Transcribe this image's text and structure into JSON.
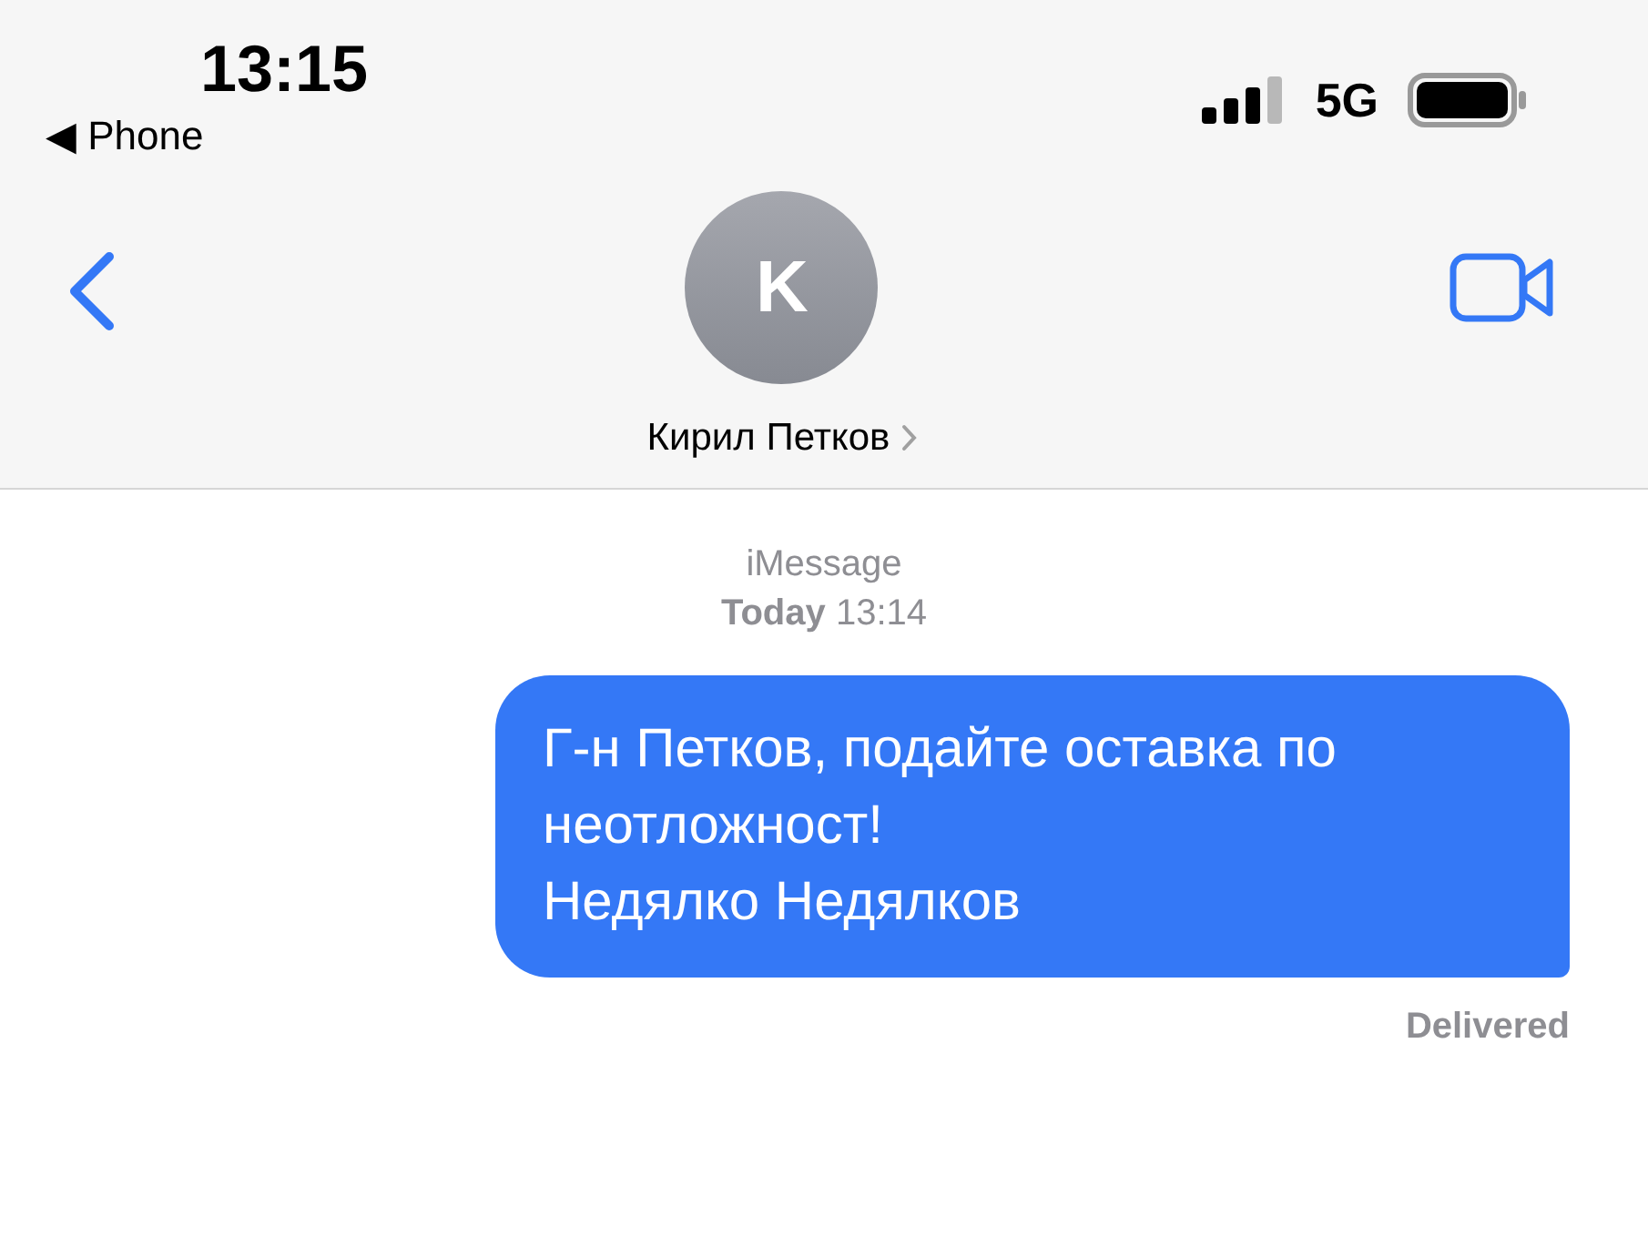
{
  "status_bar": {
    "time": "13:15",
    "back_app": "◀ Phone",
    "network": "5G"
  },
  "header": {
    "avatar_initial": "K",
    "name": "Кирил Петков"
  },
  "conversation": {
    "service": "iMessage",
    "timestamp": {
      "day": "Today",
      "time": "13:14"
    },
    "messages": [
      {
        "kind": "outgoing",
        "paragraphs": [
          "Г-н Петков, подайте оставка по неотложност!",
          "Недялко Недялков"
        ],
        "status": "Delivered"
      }
    ]
  }
}
